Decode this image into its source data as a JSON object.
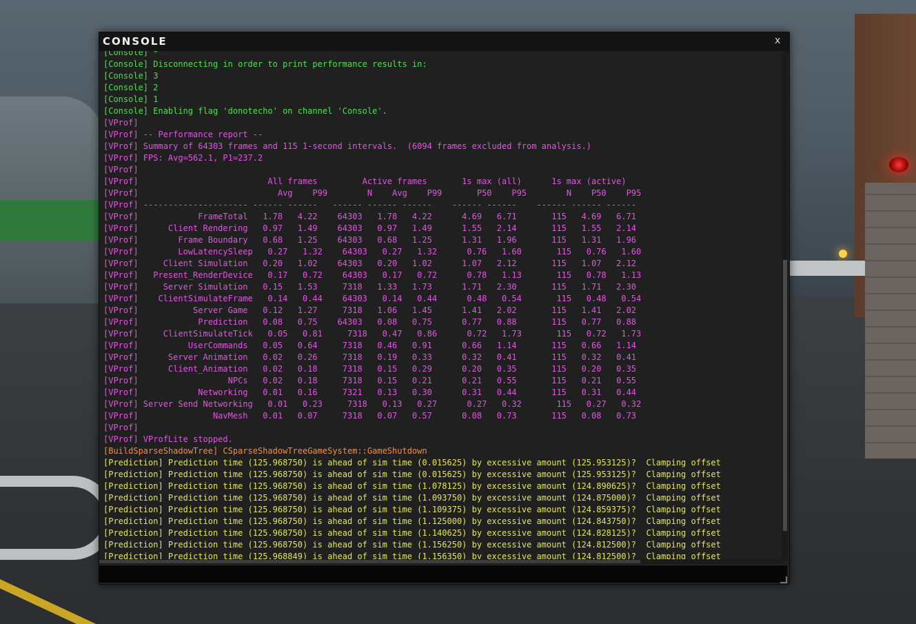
{
  "window": {
    "title": "CONSOLE",
    "close_label": "x"
  },
  "log": [
    {
      "t": "[Console] *",
      "c": "console"
    },
    {
      "t": "[Console] Disconnecting in order to print performance results in:",
      "c": "console"
    },
    {
      "t": "[Console] 3",
      "c": "console"
    },
    {
      "t": "[Console] 2",
      "c": "console"
    },
    {
      "t": "[Console] 1",
      "c": "console"
    },
    {
      "t": "[Console] Enabling flag 'donotecho' on channel 'Console'.",
      "c": "console"
    },
    {
      "t": "[VProf]",
      "c": "vprof"
    },
    {
      "t": "[VProf] -- Performance report --",
      "c": "vprof"
    },
    {
      "t": "[VProf] Summary of 64303 frames and 115 1-second intervals.  (6094 frames excluded from analysis.)",
      "c": "vprof"
    },
    {
      "t": "[VProf] FPS: Avg=562.1, P1=237.2",
      "c": "vprof"
    },
    {
      "t": "[VProf]",
      "c": "vprof"
    },
    {
      "t": "[VProf]                          All frames         Active frames       1s max (all)      1s max (active)",
      "c": "vprof"
    },
    {
      "t": "[VProf]                            Avg    P99        N    Avg    P99       P50    P95        N    P50    P95",
      "c": "vprof"
    },
    {
      "t": "[VProf] --------------------- ------ ------   ------ ------ ------    ------ ------    ------ ------ ------",
      "c": "vprof"
    },
    {
      "t": "[VProf]            FrameTotal   1.78   4.22    64303   1.78   4.22      4.69   6.71       115   4.69   6.71",
      "c": "vprof"
    },
    {
      "t": "[VProf]      Client Rendering   0.97   1.49    64303   0.97   1.49      1.55   2.14       115   1.55   2.14",
      "c": "vprof"
    },
    {
      "t": "[VProf]        Frame Boundary   0.68   1.25    64303   0.68   1.25      1.31   1.96       115   1.31   1.96",
      "c": "vprof"
    },
    {
      "t": "[VProf]        LowLatencySleep   0.27   1.32    64303   0.27   1.32      0.76   1.60       115   0.76   1.60",
      "c": "vprof"
    },
    {
      "t": "[VProf]     Client Simulation   0.20   1.02    64303   0.20   1.02      1.07   2.12       115   1.07   2.12",
      "c": "vprof"
    },
    {
      "t": "[VProf]   Present_RenderDevice   0.17   0.72    64303   0.17   0.72      0.78   1.13       115   0.78   1.13",
      "c": "vprof"
    },
    {
      "t": "[VProf]     Server Simulation   0.15   1.53     7318   1.33   1.73      1.71   2.30       115   1.71   2.30",
      "c": "vprof"
    },
    {
      "t": "[VProf]    ClientSimulateFrame   0.14   0.44    64303   0.14   0.44      0.48   0.54       115   0.48   0.54",
      "c": "vprof"
    },
    {
      "t": "[VProf]           Server Game   0.12   1.27     7318   1.06   1.45      1.41   2.02       115   1.41   2.02",
      "c": "vprof"
    },
    {
      "t": "[VProf]            Prediction   0.08   0.75    64303   0.08   0.75      0.77   0.88       115   0.77   0.88",
      "c": "vprof"
    },
    {
      "t": "[VProf]     ClientSimulateTick   0.05   0.81     7318   0.47   0.86      0.72   1.73       115   0.72   1.73",
      "c": "vprof"
    },
    {
      "t": "[VProf]          UserCommands   0.05   0.64     7318   0.46   0.91      0.66   1.14       115   0.66   1.14",
      "c": "vprof"
    },
    {
      "t": "[VProf]      Server Animation   0.02   0.26     7318   0.19   0.33      0.32   0.41       115   0.32   0.41",
      "c": "vprof"
    },
    {
      "t": "[VProf]      Client_Animation   0.02   0.18     7318   0.15   0.29      0.20   0.35       115   0.20   0.35",
      "c": "vprof"
    },
    {
      "t": "[VProf]                  NPCs   0.02   0.18     7318   0.15   0.21      0.21   0.55       115   0.21   0.55",
      "c": "vprof"
    },
    {
      "t": "[VProf]            Networking   0.01   0.16     7321   0.13   0.30      0.31   0.44       115   0.31   0.44",
      "c": "vprof"
    },
    {
      "t": "[VProf] Server Send Networking   0.01   0.23     7318   0.13   0.27      0.27   0.32       115   0.27   0.32",
      "c": "vprof"
    },
    {
      "t": "[VProf]               NavMesh   0.01   0.07     7318   0.07   0.57      0.08   0.73       115   0.08   0.73",
      "c": "vprof"
    },
    {
      "t": "[VProf]",
      "c": "vprof"
    },
    {
      "t": "[VProf] VProfLite stopped.",
      "c": "vprof"
    },
    {
      "t": "[BuildSparseShadowTree] CSparseShadowTreeGameSystem::GameShutdown",
      "c": "build"
    },
    {
      "t": "[Prediction] Prediction time (125.968750) is ahead of sim time (0.015625) by excessive amount (125.953125)?  Clamping offset",
      "c": "pred"
    },
    {
      "t": "[Prediction] Prediction time (125.968750) is ahead of sim time (0.015625) by excessive amount (125.953125)?  Clamping offset",
      "c": "pred"
    },
    {
      "t": "[Prediction] Prediction time (125.968750) is ahead of sim time (1.078125) by excessive amount (124.890625)?  Clamping offset",
      "c": "pred"
    },
    {
      "t": "[Prediction] Prediction time (125.968750) is ahead of sim time (1.093750) by excessive amount (124.875000)?  Clamping offset",
      "c": "pred"
    },
    {
      "t": "[Prediction] Prediction time (125.968750) is ahead of sim time (1.109375) by excessive amount (124.859375)?  Clamping offset",
      "c": "pred"
    },
    {
      "t": "[Prediction] Prediction time (125.968750) is ahead of sim time (1.125000) by excessive amount (124.843750)?  Clamping offset",
      "c": "pred"
    },
    {
      "t": "[Prediction] Prediction time (125.968750) is ahead of sim time (1.140625) by excessive amount (124.828125)?  Clamping offset",
      "c": "pred"
    },
    {
      "t": "[Prediction] Prediction time (125.968750) is ahead of sim time (1.156250) by excessive amount (124.812500)?  Clamping offset",
      "c": "pred"
    },
    {
      "t": "[Prediction] Prediction time (125.968849) is ahead of sim time (1.156350) by excessive amount (124.812500)?  Clamping offset",
      "c": "pred"
    }
  ],
  "input": {
    "value": "",
    "placeholder": ""
  },
  "colors": {
    "console": "#4fe04f",
    "vprof": "#e056e0",
    "build": "#ff8a3a",
    "prediction": "#e2e65a"
  }
}
